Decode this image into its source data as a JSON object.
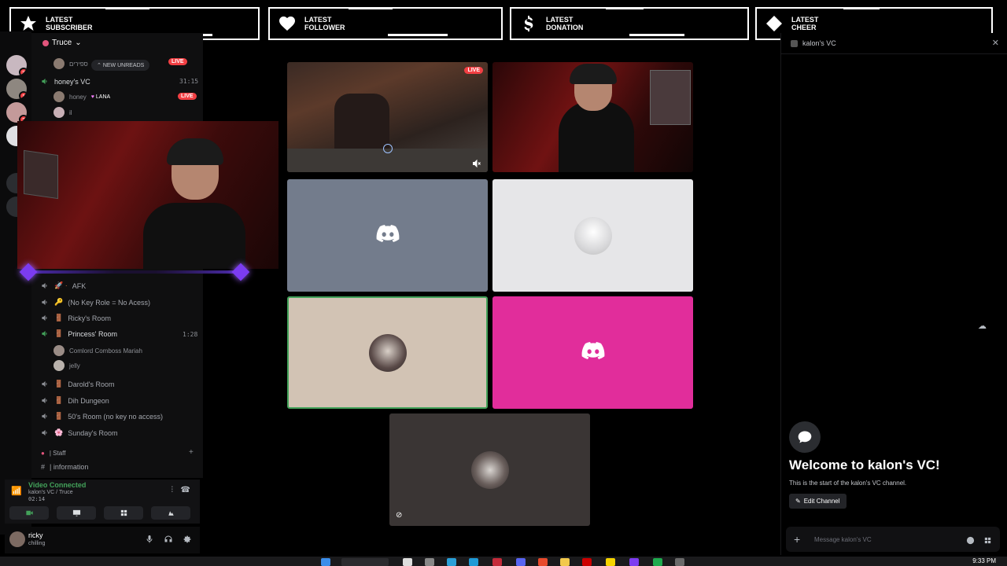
{
  "alerts": [
    {
      "line1": "Latest",
      "line2": "Subscriber",
      "icon": "star-icon"
    },
    {
      "line1": "Latest",
      "line2": "Follower",
      "icon": "heart-icon"
    },
    {
      "line1": "Latest",
      "line2": "Donation",
      "icon": "dollar-icon"
    },
    {
      "line1": "Latest",
      "line2": "Cheer",
      "icon": "diamond-icon"
    }
  ],
  "rail": {
    "badges": [
      "3",
      "1",
      "2"
    ]
  },
  "sidebar": {
    "server_name": "Truce",
    "new_unreads": "NEW UNREADS",
    "top_member": "ספירים",
    "live_label": "LIVE",
    "honey_vc": {
      "name": "honey's VC",
      "time": "31:15"
    },
    "honey_member": {
      "name": "honey",
      "status": "LANA"
    },
    "small_member": "il",
    "channels": [
      {
        "label": "AFK",
        "prefix": "🚀 ·"
      },
      {
        "label": "(No Key Role = No Acess)",
        "prefix": "🔑"
      },
      {
        "label": "Ricky's Room",
        "prefix": "🚪"
      },
      {
        "label": "Princess' Room",
        "prefix": "🚪",
        "time": "1:28",
        "active": true
      },
      {
        "label": "Darold's Room",
        "prefix": "🚪"
      },
      {
        "label": "Dih Dungeon",
        "prefix": "🚪"
      },
      {
        "label": "50's Room (no key no access)",
        "prefix": "🚪"
      },
      {
        "label": "Sunday's Room",
        "prefix": "🌸"
      }
    ],
    "princess_members": [
      "Comlord Comboss Mariah",
      "jelly"
    ],
    "category": "| Staff",
    "info_channel": "| information"
  },
  "voice": {
    "status": "Video Connected",
    "location": "kalon's VC / Truce",
    "elapsed": "02:14"
  },
  "user": {
    "name": "ricky",
    "status": "chilling"
  },
  "grid": {
    "live_label": "LIVE",
    "tiles": [
      {
        "type": "game",
        "live": true
      },
      {
        "type": "webcam"
      },
      {
        "type": "discord-logo",
        "bg": "#737c8c"
      },
      {
        "type": "avatar",
        "bg": "#e6e6e8"
      },
      {
        "type": "avatar",
        "bg": "#d2c3b4",
        "speaking": true
      },
      {
        "type": "discord-logo",
        "bg": "#e12d9b"
      },
      {
        "type": "avatar",
        "bg": "#3a3534"
      }
    ]
  },
  "chat": {
    "channel": "kalon's VC",
    "welcome_title": "Welcome to kalon's VC!",
    "welcome_sub": "This is the start of the kalon's VC channel.",
    "edit_label": "Edit Channel",
    "placeholder": "Message kalon's VC"
  },
  "taskbar": {
    "clock": "9:33 PM"
  }
}
